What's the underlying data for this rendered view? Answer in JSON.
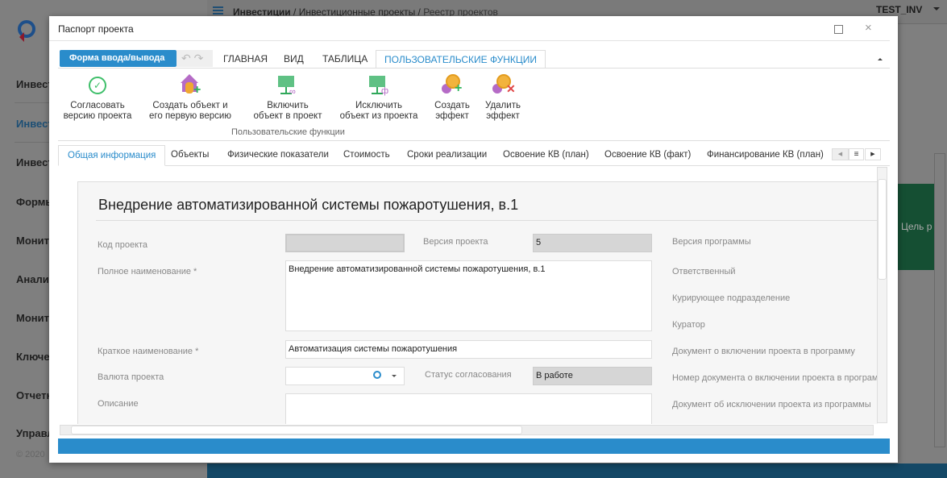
{
  "background": {
    "breadcrumb": [
      "Инвестиции",
      "Инвестиционные проекты",
      "Реестр проектов"
    ],
    "user": "TEST_INV",
    "sidebar": [
      "Инвест",
      "Инвест",
      "Инвест",
      "Формы",
      "Монит",
      "Аналит",
      "Монит",
      "Ключе",
      "Отчетн",
      "Управл"
    ],
    "copyright": "© 2020",
    "card_text": "Цель р"
  },
  "modal": {
    "title": "Паспорт проекта",
    "form_button": "Форма ввода/вывода",
    "ribbon_tabs": [
      "ГЛАВНАЯ",
      "ВИД",
      "ТАБЛИЦА",
      "ПОЛЬЗОВАТЕЛЬСКИЕ ФУНКЦИИ"
    ],
    "ribbon_buttons": [
      {
        "l1": "Согласовать",
        "l2": "версию проекта",
        "icon": "check-circle-icon"
      },
      {
        "l1": "Создать объект и",
        "l2": "его первую версию",
        "icon": "house-coins-add-icon"
      },
      {
        "l1": "Включить",
        "l2": "объект в проект",
        "icon": "board-link-icon"
      },
      {
        "l1": "Исключить",
        "l2": "объект из проекта",
        "icon": "board-unlink-icon"
      },
      {
        "l1": "Создать",
        "l2": "эффект",
        "icon": "coin-add-icon"
      },
      {
        "l1": "Удалить",
        "l2": "эффект",
        "icon": "coin-remove-icon"
      }
    ],
    "ribbon_group": "Пользовательские функции",
    "page_tabs": [
      "Общая информация",
      "Объекты",
      "Физические показатели",
      "Стоимость",
      "Сроки реализации",
      "Освоение КВ (план)",
      "Освоение КВ (факт)",
      "Финансирование КВ (план)"
    ],
    "form": {
      "heading": "Внедрение автоматизированной системы пожаротушения, в.1",
      "code_label": "Код проекта",
      "code_value": "",
      "version_label": "Версия проекта",
      "version_value": "5",
      "full_name_label": "Полное наименование *",
      "full_name_value": "Внедрение автоматизированной системы пожаротушения, в.1",
      "short_name_label": "Краткое наименование *",
      "short_name_value": "Автоматизация системы пожаротушения",
      "currency_label": "Валюта проекта",
      "currency_value": "",
      "status_label": "Статус согласования",
      "status_value": "В работе",
      "description_label": "Описание",
      "right_labels": [
        "Версия программы",
        "Ответственный",
        "Курирующее подразделение",
        "Куратор",
        "Документ о включении проекта в программу",
        "Номер документа о включении проекта в программу",
        "Документ об исключении проекта из программы"
      ]
    }
  },
  "colors": {
    "accent": "#2a8ccb",
    "overlay": "#7f7f7f",
    "navy": "#144866",
    "green": "#154f33"
  }
}
